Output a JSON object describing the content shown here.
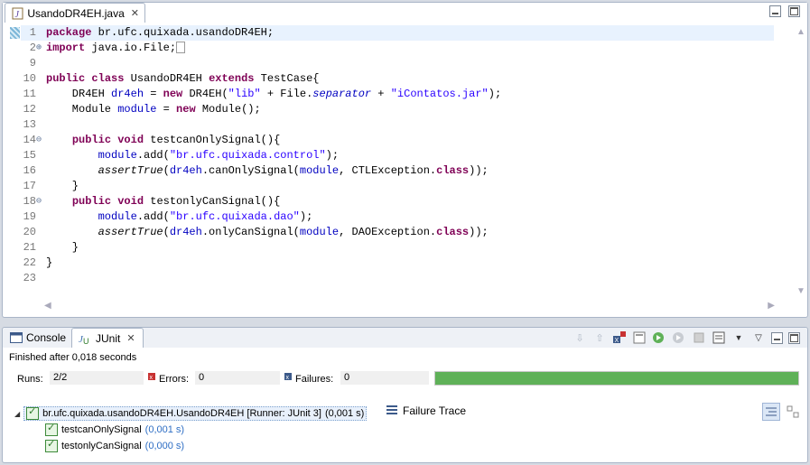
{
  "editor": {
    "tab_label": "UsandoDR4EH.java",
    "tab_icon": "java-file-icon",
    "lines": [
      {
        "n": "1",
        "fold": "",
        "html": "<span class=\"kw\">package</span> br.ufc.quixada.usandoDR4EH;"
      },
      {
        "n": "2",
        "fold": "⊕",
        "html": "<span class=\"kw\">import</span> java.io.File;<span class=\"collapsed\"></span>"
      },
      {
        "n": "9",
        "fold": "",
        "html": ""
      },
      {
        "n": "10",
        "fold": "",
        "html": "<span class=\"kw\">public</span> <span class=\"kw\">class</span> UsandoDR4EH <span class=\"kw\">extends</span> TestCase{"
      },
      {
        "n": "11",
        "fold": "",
        "html": "    DR4EH <span class=\"fld\">dr4eh</span> = <span class=\"kw\">new</span> DR4EH(<span class=\"str\">\"lib\"</span> + File.<span class=\"stat\">separator</span> + <span class=\"str\">\"iContatos.jar\"</span>);"
      },
      {
        "n": "12",
        "fold": "",
        "html": "    Module <span class=\"fld\">module</span> = <span class=\"kw\">new</span> Module();"
      },
      {
        "n": "13",
        "fold": "",
        "html": ""
      },
      {
        "n": "14",
        "fold": "⊖",
        "html": "    <span class=\"kw\">public</span> <span class=\"kw\">void</span> testcanOnlySignal(){"
      },
      {
        "n": "15",
        "fold": "",
        "html": "        <span class=\"fld\">module</span>.add(<span class=\"str\">\"br.ufc.quixada.control\"</span>);"
      },
      {
        "n": "16",
        "fold": "",
        "html": "        <span class=\"stm\">assertTrue</span>(<span class=\"fld\">dr4eh</span>.canOnlySignal(<span class=\"fld\">module</span>, CTLException.<span class=\"kw\">class</span>));"
      },
      {
        "n": "17",
        "fold": "",
        "html": "    }"
      },
      {
        "n": "18",
        "fold": "⊖",
        "html": "    <span class=\"kw\">public</span> <span class=\"kw\">void</span> testonlyCanSignal(){"
      },
      {
        "n": "19",
        "fold": "",
        "html": "        <span class=\"fld\">module</span>.add(<span class=\"str\">\"br.ufc.quixada.dao\"</span>);"
      },
      {
        "n": "20",
        "fold": "",
        "html": "        <span class=\"stm\">assertTrue</span>(<span class=\"fld\">dr4eh</span>.onlyCanSignal(<span class=\"fld\">module</span>, DAOException.<span class=\"kw\">class</span>));"
      },
      {
        "n": "21",
        "fold": "",
        "html": "    }"
      },
      {
        "n": "22",
        "fold": "",
        "html": "}"
      },
      {
        "n": "23",
        "fold": "",
        "html": ""
      }
    ]
  },
  "bottom": {
    "tabs": [
      {
        "label": "Console",
        "icon": "console-icon"
      },
      {
        "label": "JUnit",
        "icon": "junit-icon"
      }
    ],
    "status": "Finished after 0,018 seconds",
    "runs_label": "Runs:",
    "runs_value": "2/2",
    "errors_label": "Errors:",
    "errors_value": "0",
    "failures_label": "Failures:",
    "failures_value": "0",
    "progress_color": "#5fb158",
    "progress_fraction": 1.0,
    "tree": {
      "root_label": "br.ufc.quixada.usandoDR4EH.UsandoDR4EH [Runner: JUnit 3]",
      "root_time": "(0,001 s)",
      "children": [
        {
          "label": "testcanOnlySignal",
          "time": "(0,001 s)"
        },
        {
          "label": "testonlyCanSignal",
          "time": "(0,000 s)"
        }
      ]
    },
    "failure_trace_label": "Failure Trace"
  }
}
